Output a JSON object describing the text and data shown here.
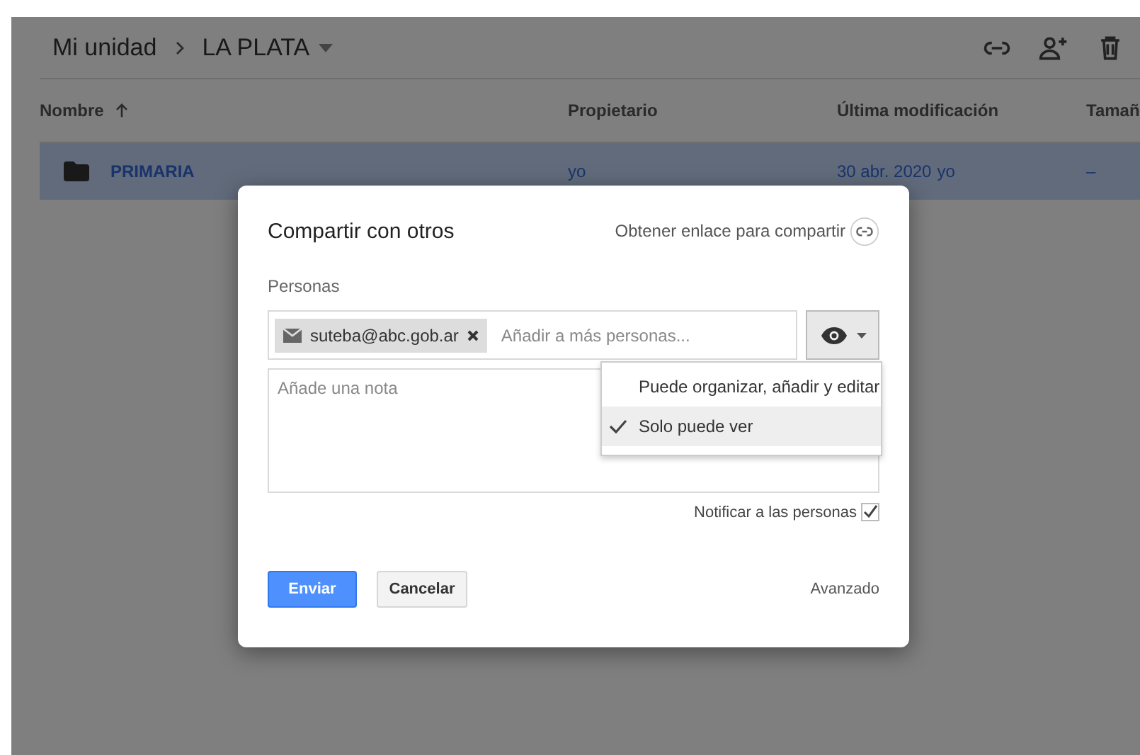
{
  "breadcrumb": {
    "root": "Mi unidad",
    "current": "LA PLATA"
  },
  "columns": [
    "Nombre",
    "Propietario",
    "Última modificación",
    "Tamañ"
  ],
  "rows": [
    {
      "name": "PRIMARIA",
      "owner": "yo",
      "modified": "30 abr. 2020",
      "modified_by": "yo",
      "size": "–",
      "selected": true
    }
  ],
  "dialog": {
    "title": "Compartir con otros",
    "link": "Obtener enlace para compartir",
    "people_label": "Personas",
    "chips": [
      {
        "email": "suteba@abc.gob.ar"
      }
    ],
    "people_placeholder": "Añadir a más personas...",
    "permission": {
      "expanded": true,
      "options": [
        {
          "label": "Puede organizar, añadir y editar",
          "selected": false
        },
        {
          "label": "Solo puede ver",
          "selected": true
        }
      ]
    },
    "note_placeholder": "Añade una nota",
    "notify": {
      "label": "Notificar a las personas",
      "checked": true
    },
    "send": "Enviar",
    "cancel": "Cancelar",
    "advanced": "Avanzado"
  }
}
